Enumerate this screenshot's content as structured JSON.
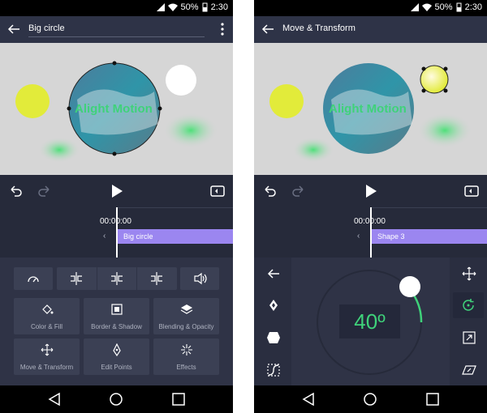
{
  "status": {
    "battery": "50%",
    "time": "2:30"
  },
  "left": {
    "title": "Big circle",
    "canvas_text": "Alight Motion",
    "timecode": "00:00:00",
    "clip_label": "Big circle",
    "buttons": {
      "color_fill": "Color & Fill",
      "border_shadow": "Border & Shadow",
      "blending_opacity": "Blending & Opacity",
      "move_transform": "Move & Transform",
      "edit_points": "Edit Points",
      "effects": "Effects"
    }
  },
  "right": {
    "title": "Move & Transform",
    "canvas_text": "Alight Motion",
    "timecode": "00:00:00",
    "clip_label": "Shape 3",
    "angle": "40º"
  },
  "colors": {
    "bg": "#262a3a",
    "appbar": "#2e3347",
    "panel": "#2f3346",
    "accent_green": "#3fd27a",
    "clip_purple": "#9b86f0",
    "circle_yellow": "#e2eb3a"
  }
}
